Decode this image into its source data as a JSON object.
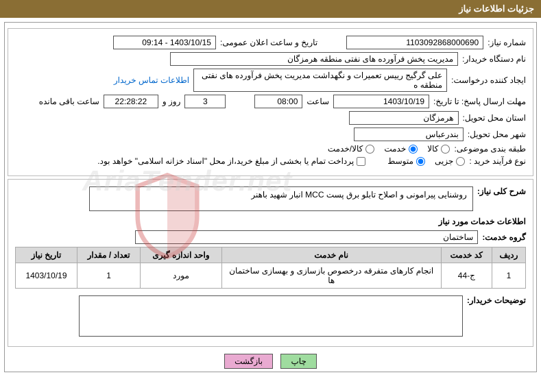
{
  "header_title": "جزئیات اطلاعات نیاز",
  "labels": {
    "need_number": "شماره نیاز:",
    "announce_datetime": "تاریخ و ساعت اعلان عمومی:",
    "buyer_device": "نام دستگاه خریدار:",
    "request_creator": "ایجاد کننده درخواست:",
    "contact_link": "اطلاعات تماس خریدار",
    "response_deadline": "مهلت ارسال پاسخ: تا تاریخ:",
    "hour_label": "ساعت",
    "days_and": "روز و",
    "remaining": "ساعت باقی مانده",
    "delivery_province": "استان محل تحویل:",
    "delivery_city": "شهر محل تحویل:",
    "subject_category": "طبقه بندی موضوعی:",
    "cat_goods": "کالا",
    "cat_service": "خدمت",
    "cat_goods_service": "کالا/خدمت",
    "purchase_type": "نوع فرآیند خرید :",
    "type_partial": "جزیی",
    "type_medium": "متوسط",
    "payment_note": "پرداخت تمام یا بخشی از مبلغ خرید،از محل \"اسناد خزانه اسلامی\" خواهد بود.",
    "general_desc": "شرح کلی نیاز:",
    "service_info_title": "اطلاعات خدمات مورد نیاز",
    "service_group": "گروه خدمت:",
    "buyer_notes": "توضیحات خریدار:"
  },
  "values": {
    "need_number": "1103092868000690",
    "announce_datetime": "1403/10/15 - 09:14",
    "buyer_device": "مدیریت پخش فرآورده های نفتی منطقه هرمزگان",
    "request_creator": "علی گرگیج رییس تعمیرات و نگهداشت مدیریت پخش فرآورده های نفتی منطقه ه",
    "deadline_date": "1403/10/19",
    "deadline_time": "08:00",
    "days_left": "3",
    "time_left": "22:28:22",
    "province": "هرمزگان",
    "city": "بندرعباس",
    "general_desc": "روشنایی پیرامونی و اصلاح تابلو برق پست MCC انبار شهید باهنر",
    "service_group": "ساختمان"
  },
  "radio_selected": {
    "category": "خدمت",
    "purchase_type": "متوسط"
  },
  "table": {
    "headers": [
      "ردیف",
      "کد خدمت",
      "نام خدمت",
      "واحد اندازه گیری",
      "تعداد / مقدار",
      "تاریخ نیاز"
    ],
    "rows": [
      {
        "row": "1",
        "code": "ج-44",
        "name": "انجام کارهای متفرقه درخصوص بازسازی و بهسازی ساختمان ها",
        "unit": "مورد",
        "qty": "1",
        "date": "1403/10/19"
      }
    ]
  },
  "buttons": {
    "print": "چاپ",
    "back": "بازگشت"
  },
  "watermark": "AriaTender.net"
}
